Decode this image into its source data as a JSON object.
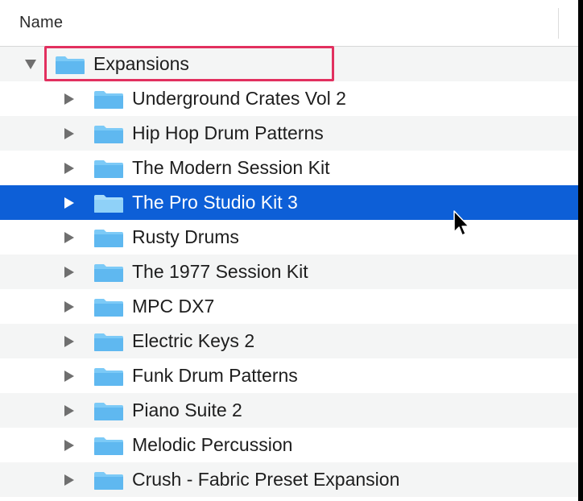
{
  "header": {
    "column_name": "Name"
  },
  "colors": {
    "selection": "#0d5fd7",
    "folder": "#6fc1f5",
    "highlight_box": "#e2305f",
    "alt_row": "#f4f5f5"
  },
  "tree": {
    "root": {
      "label": "Expansions",
      "expanded": true,
      "icon": "folder-icon"
    },
    "children": [
      {
        "label": "Underground Crates Vol 2",
        "icon": "folder-icon",
        "expanded": false
      },
      {
        "label": "Hip Hop Drum Patterns",
        "icon": "folder-icon",
        "expanded": false
      },
      {
        "label": "The Modern Session Kit",
        "icon": "folder-icon",
        "expanded": false
      },
      {
        "label": "The Pro Studio Kit 3",
        "icon": "folder-icon",
        "expanded": false,
        "selected": true
      },
      {
        "label": "Rusty Drums",
        "icon": "folder-icon",
        "expanded": false
      },
      {
        "label": "The 1977 Session Kit",
        "icon": "folder-icon",
        "expanded": false
      },
      {
        "label": "MPC DX7",
        "icon": "folder-icon",
        "expanded": false
      },
      {
        "label": "Electric Keys 2",
        "icon": "folder-icon",
        "expanded": false
      },
      {
        "label": "Funk Drum Patterns",
        "icon": "folder-icon",
        "expanded": false
      },
      {
        "label": "Piano Suite 2",
        "icon": "folder-icon",
        "expanded": false
      },
      {
        "label": "Melodic Percussion",
        "icon": "folder-icon",
        "expanded": false
      },
      {
        "label": "Crush - Fabric Preset Expansion",
        "icon": "folder-icon",
        "expanded": false
      }
    ]
  },
  "cursor": {
    "icon": "mouse-pointer-icon"
  }
}
